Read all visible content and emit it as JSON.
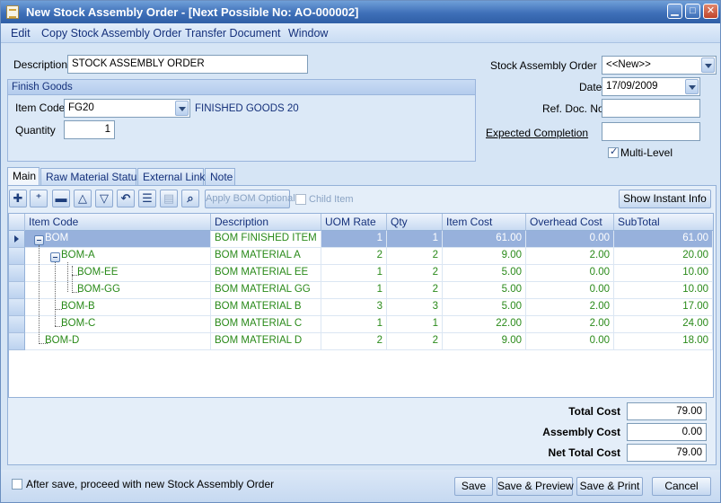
{
  "window": {
    "title": "New Stock Assembly Order  - [Next Possible No: AO-000002]",
    "minimize": "▁",
    "maximize": "□",
    "close": "✕"
  },
  "menu": [
    "Edit",
    "Copy Stock Assembly Order",
    "Transfer Document",
    "Window"
  ],
  "form": {
    "description_label": "Description",
    "description_value": "STOCK ASSEMBLY ORDER",
    "order_no_label": "Stock Assembly Order No",
    "order_no_value": "<<New>>",
    "date_label": "Date",
    "date_value": "17/09/2009",
    "ref_doc_label": "Ref. Doc. No",
    "ref_doc_value": "",
    "expected_label": "Expected Completion",
    "expected_value": "",
    "multilevel_label": "Multi-Level",
    "multilevel_checked": true
  },
  "finish_goods": {
    "heading": "Finish Goods",
    "item_code_label": "Item Code",
    "item_code_value": "FG20",
    "item_name": "FINISHED GOODS 20",
    "quantity_label": "Quantity",
    "quantity_value": "1"
  },
  "tabs": [
    "Main",
    "Raw Material Status",
    "External Link",
    "Note"
  ],
  "toolbar": {
    "apply_bom": "Apply BOM Optional",
    "child_item": "Child Item",
    "show_instant_info": "Show Instant Info"
  },
  "grid": {
    "headers": [
      "Item Code",
      "Description",
      "UOM Rate",
      "Qty",
      "Item Cost",
      "Overhead Cost",
      "SubTotal"
    ],
    "rows": [
      {
        "code": "BOM",
        "desc": "BOM FINISHED ITEM",
        "uom": "1",
        "qty": "1",
        "cost": "61.00",
        "overhead": "0.00",
        "subtotal": "61.00"
      },
      {
        "code": "BOM-A",
        "desc": "BOM MATERIAL A",
        "uom": "2",
        "qty": "2",
        "cost": "9.00",
        "overhead": "2.00",
        "subtotal": "20.00"
      },
      {
        "code": "BOM-EE",
        "desc": "BOM MATERIAL EE",
        "uom": "1",
        "qty": "2",
        "cost": "5.00",
        "overhead": "0.00",
        "subtotal": "10.00"
      },
      {
        "code": "BOM-GG",
        "desc": "BOM MATERIAL GG",
        "uom": "1",
        "qty": "2",
        "cost": "5.00",
        "overhead": "0.00",
        "subtotal": "10.00"
      },
      {
        "code": "BOM-B",
        "desc": "BOM MATERIAL B",
        "uom": "3",
        "qty": "3",
        "cost": "5.00",
        "overhead": "2.00",
        "subtotal": "17.00"
      },
      {
        "code": "BOM-C",
        "desc": "BOM MATERIAL C",
        "uom": "1",
        "qty": "1",
        "cost": "22.00",
        "overhead": "2.00",
        "subtotal": "24.00"
      },
      {
        "code": "BOM-D",
        "desc": "BOM MATERIAL D",
        "uom": "2",
        "qty": "2",
        "cost": "9.00",
        "overhead": "0.00",
        "subtotal": "18.00"
      }
    ]
  },
  "totals": {
    "total_cost_label": "Total Cost",
    "total_cost_value": "79.00",
    "assembly_cost_label": "Assembly Cost",
    "assembly_cost_value": "0.00",
    "net_total_label": "Net Total Cost",
    "net_total_value": "79.00"
  },
  "footer": {
    "proceed_label": "After save, proceed with new Stock Assembly Order",
    "save": "Save",
    "save_preview": "Save & Preview",
    "save_print": "Save & Print",
    "cancel": "Cancel"
  },
  "colors": {
    "title_bar": "#3e6fb8",
    "window_bg": "#d6e5f5",
    "grid_text": "#2a8a1a",
    "selected_row": "#97b1dc"
  },
  "icons": [
    "add-row-icon",
    "insert-row-icon",
    "delete-row-icon",
    "move-up-icon",
    "move-down-icon",
    "undo-icon",
    "list-icon",
    "disabled-list-icon",
    "search-icon"
  ]
}
